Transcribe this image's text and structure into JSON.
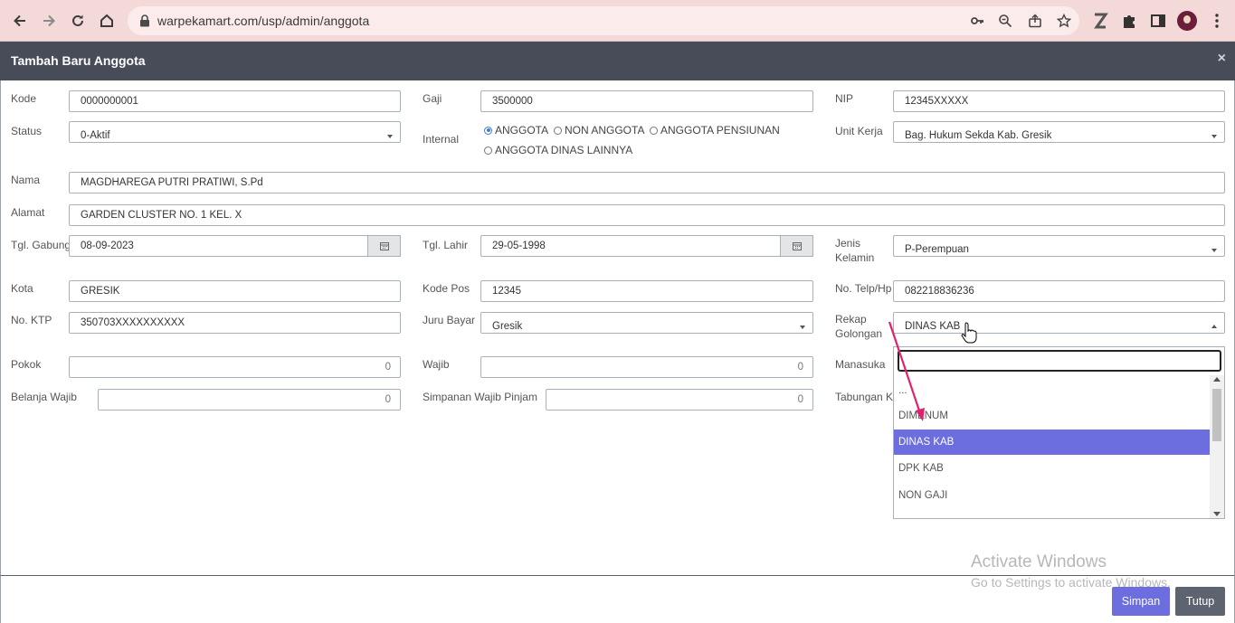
{
  "browser": {
    "url": "warpekamart.com/usp/admin/anggota"
  },
  "modal": {
    "title": "Tambah Baru Anggota",
    "close_glyph": "×"
  },
  "form": {
    "kode": {
      "label": "Kode",
      "value": "0000000001"
    },
    "gaji": {
      "label": "Gaji",
      "value": "3500000"
    },
    "nip": {
      "label": "NIP",
      "value": "12345XXXXX"
    },
    "status": {
      "label": "Status",
      "value": "0-Aktif"
    },
    "internal": {
      "label": "Internal",
      "options": [
        "ANGGOTA",
        "NON ANGGOTA",
        "ANGGOTA PENSIUNAN",
        "ANGGOTA DINAS LAINNYA"
      ],
      "selected": "ANGGOTA"
    },
    "unit_kerja": {
      "label": "Unit Kerja",
      "value": "Bag. Hukum Sekda Kab. Gresik"
    },
    "nama": {
      "label": "Nama",
      "value": "MAGDHAREGA PUTRI PRATIWI, S.Pd"
    },
    "alamat": {
      "label": "Alamat",
      "value": "GARDEN CLUSTER NO. 1 KEL. X"
    },
    "tgl_gabung": {
      "label": "Tgl. Gabung",
      "value": "08-09-2023"
    },
    "tgl_lahir": {
      "label": "Tgl. Lahir",
      "value": "29-05-1998"
    },
    "jenis_kelamin": {
      "label_1": "Jenis",
      "label_2": "Kelamin",
      "value": "P-Perempuan"
    },
    "kota": {
      "label": "Kota",
      "value": "GRESIK"
    },
    "kode_pos": {
      "label": "Kode Pos",
      "value": "12345"
    },
    "no_telp": {
      "label": "No. Telp/Hp",
      "value": "082218836236"
    },
    "no_ktp": {
      "label": "No. KTP",
      "value": "350703XXXXXXXXXX"
    },
    "juru_bayar": {
      "label": "Juru Bayar",
      "value": "Gresik"
    },
    "rekap_golongan": {
      "label_1": "Rekap",
      "label_2": "Golongan",
      "value": "DINAS KAB"
    },
    "pokok": {
      "label": "Pokok",
      "value": "0"
    },
    "wajib": {
      "label": "Wajib",
      "value": "0"
    },
    "manasuka": {
      "label": "Manasuka"
    },
    "belanja_wajib": {
      "label": "Belanja Wajib",
      "value": "0"
    },
    "simpanan_wajib_pinjam": {
      "label": "Simpanan Wajib Pinjam",
      "value": "0"
    },
    "tabungan": {
      "label": "Tabungan Kh"
    }
  },
  "dropdown": {
    "search_value": "",
    "items": [
      "...",
      "DIMENUM",
      "DINAS KAB",
      "DPK KAB",
      "NON GAJI"
    ],
    "selected": "DINAS KAB"
  },
  "footer": {
    "save_label": "Simpan",
    "close_label": "Tutup"
  },
  "watermark": {
    "line1": "Activate Windows",
    "line2": "Go to Settings to activate Windows."
  },
  "colors": {
    "primary": "#6c6ee0",
    "secondary": "#5d6470",
    "header": "#474c58",
    "arrow": "#e0216f"
  }
}
